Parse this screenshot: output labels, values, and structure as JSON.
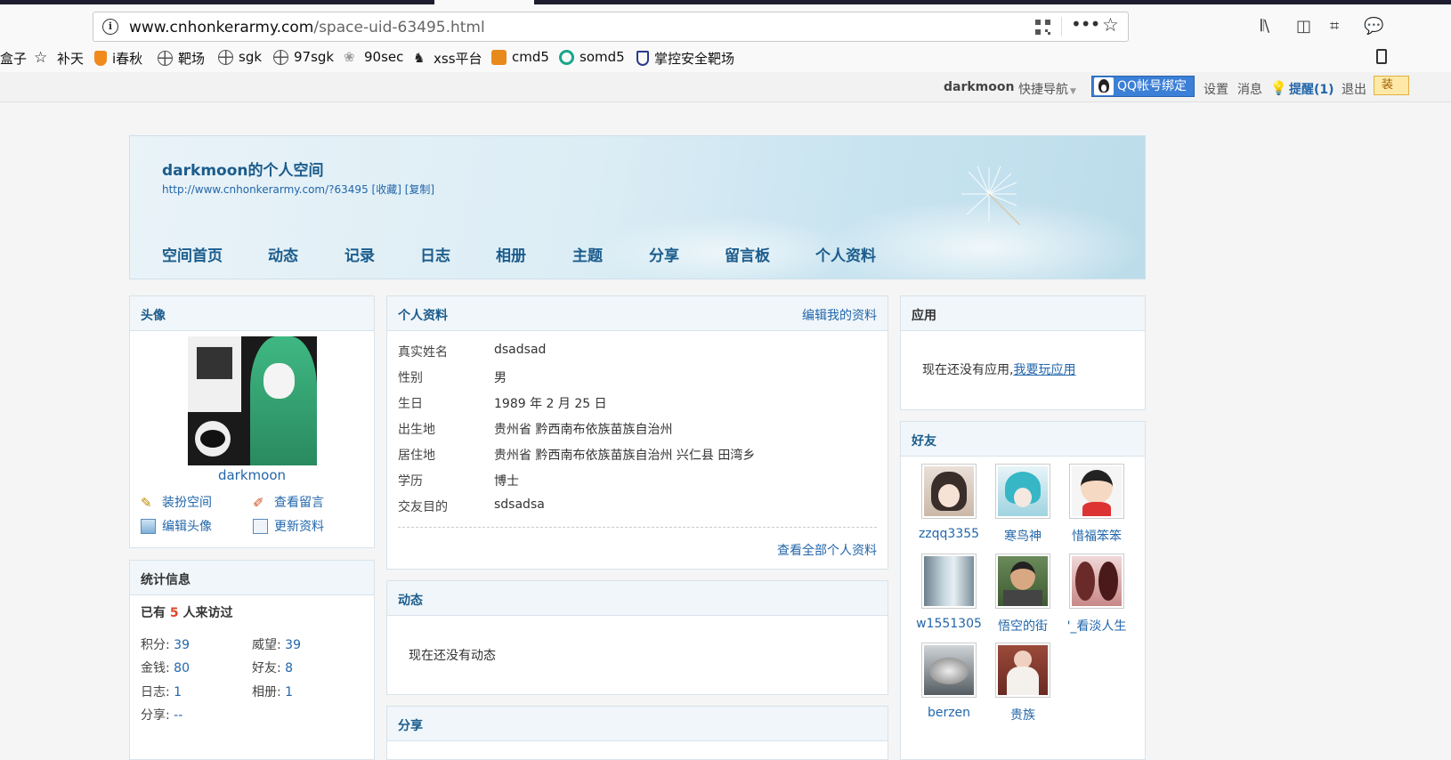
{
  "browser": {
    "url_host": "www.cnhonkerarmy.com",
    "url_path": "/space-uid-63495.html",
    "bookmarks": [
      {
        "label": "盒子",
        "icon": "folder-icon"
      },
      {
        "label": "补天",
        "icon": "star-icon"
      },
      {
        "label": "i春秋",
        "icon": "ichunqiu-icon"
      },
      {
        "label": "靶场",
        "icon": "globe-icon"
      },
      {
        "label": "sgk",
        "icon": "globe-icon"
      },
      {
        "label": "97sgk",
        "icon": "globe-icon"
      },
      {
        "label": "90sec",
        "icon": "feather-icon"
      },
      {
        "label": "xss平台",
        "icon": "xss-icon"
      },
      {
        "label": "cmd5",
        "icon": "cmd5-icon"
      },
      {
        "label": "somd5",
        "icon": "somd5-icon"
      },
      {
        "label": "掌控安全靶场",
        "icon": "shield-icon"
      }
    ]
  },
  "topbar": {
    "username": "darkmoon",
    "quick_nav": "快捷导航",
    "qq_bind": "QQ帐号绑定",
    "settings": "设置",
    "messages": "消息",
    "reminder": "提醒(1)",
    "logout": "退出",
    "tail": "装"
  },
  "space": {
    "title": "darkmoon的个人空间",
    "link": "http://www.cnhonkerarmy.com/?63495",
    "favorite": "[收藏]",
    "copy": "[复制]",
    "nav": [
      "空间首页",
      "动态",
      "记录",
      "日志",
      "相册",
      "主题",
      "分享",
      "留言板",
      "个人资料"
    ]
  },
  "avatar_panel": {
    "title": "头像",
    "name": "darkmoon",
    "actions": [
      "装扮空间",
      "查看留言",
      "编辑头像",
      "更新资料"
    ]
  },
  "stats_panel": {
    "title": "统计信息",
    "visit_prefix": "已有",
    "visit_count": "5",
    "visit_suffix": "人来访过",
    "items": [
      {
        "label": "积分:",
        "value": "39"
      },
      {
        "label": "威望:",
        "value": "39"
      },
      {
        "label": "金钱:",
        "value": "80"
      },
      {
        "label": "好友:",
        "value": "8"
      },
      {
        "label": "日志:",
        "value": "1"
      },
      {
        "label": "相册:",
        "value": "1"
      },
      {
        "label": "分享:",
        "value": "--"
      }
    ]
  },
  "profile_panel": {
    "title": "个人资料",
    "edit_link": "编辑我的资料",
    "rows": [
      {
        "label": "真实姓名",
        "value": "dsadsad"
      },
      {
        "label": "性别",
        "value": "男"
      },
      {
        "label": "生日",
        "value": "1989 年 2 月 25 日"
      },
      {
        "label": "出生地",
        "value": "贵州省 黔西南布依族苗族自治州"
      },
      {
        "label": "居住地",
        "value": "贵州省 黔西南布依族苗族自治州 兴仁县 田湾乡"
      },
      {
        "label": "学历",
        "value": "博士"
      },
      {
        "label": "交友目的",
        "value": "sdsadsa"
      }
    ],
    "view_all": "查看全部个人资料"
  },
  "feed_panel": {
    "title": "动态",
    "empty": "现在还没有动态"
  },
  "share_panel": {
    "title": "分享"
  },
  "apps_panel": {
    "title": "应用",
    "empty_text": "现在还没有应用,",
    "empty_link": "我要玩应用"
  },
  "friends_panel": {
    "title": "好友",
    "friends": [
      "zzqq3355",
      "寒鸟神",
      "惜福笨笨",
      "w1551305",
      "悟空的街",
      "'_看淡人生",
      "berzen",
      "贵族"
    ]
  },
  "colors": {
    "link": "#2266aa",
    "heading": "#1b5c8c",
    "panel_header": "#f0f6fa",
    "qq_button": "#3b7fd6",
    "visit_count": "#e0452b"
  }
}
